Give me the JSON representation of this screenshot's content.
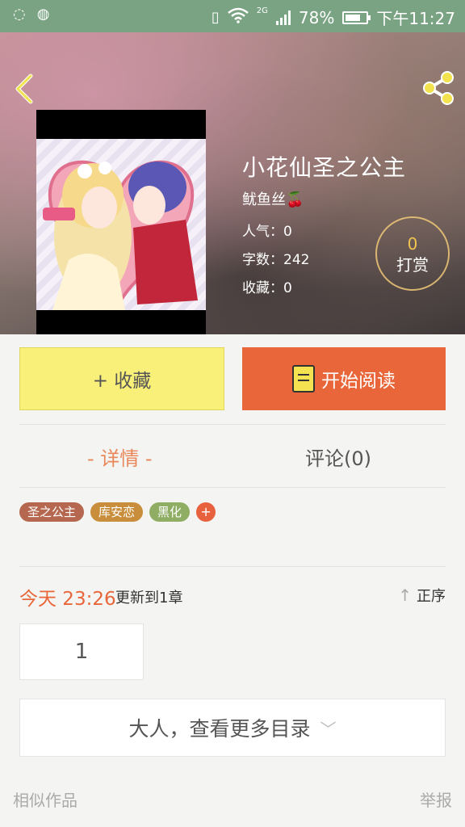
{
  "status_bar": {
    "network": "2G",
    "battery": "78%",
    "time": "下午11:27",
    "battery_level": 0.78
  },
  "book": {
    "title": "小花仙圣之公主",
    "author": "鱿鱼丝🍒",
    "popularity": "人气：0",
    "word_count": "字数：242",
    "favorites": "收藏：0"
  },
  "reward": {
    "count": "0",
    "label": "打赏"
  },
  "actions": {
    "collect_label": "+ 收藏",
    "read_label": "开始阅读"
  },
  "tabs": {
    "detail": "- 详情 -",
    "comment": "评论(0)"
  },
  "tags": [
    "圣之公主",
    "库安恋",
    "黑化"
  ],
  "tag_add": "+",
  "update": {
    "time": "今天 23:26",
    "text": "更新到1章",
    "sort_label": "正序"
  },
  "chapter": {
    "first_page": "1"
  },
  "more_catalog": "大人，查看更多目录",
  "footer": {
    "similar": "相似作品",
    "report": "举报"
  },
  "icons": [
    "back-icon",
    "share-icon",
    "book-icon",
    "arrow-up-icon",
    "chevron-down-icon"
  ]
}
